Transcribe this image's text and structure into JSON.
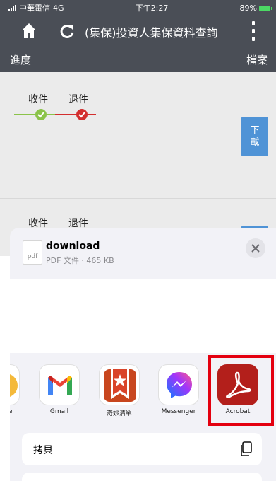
{
  "status_bar": {
    "carrier": "中華電信",
    "network": "4G",
    "time": "下午2:27",
    "battery": "89%"
  },
  "nav": {
    "title": "(集保)投資人集保資料查詢",
    "icons": [
      "home-icon",
      "refresh-icon",
      "more-menu-icon"
    ]
  },
  "table_header": {
    "left": "進度",
    "right": "檔案"
  },
  "rows": [
    {
      "step1": "收件",
      "step2": "退件",
      "download_label_1": "下",
      "download_label_2": "載"
    },
    {
      "step1": "收件",
      "step2": "退件"
    }
  ],
  "share_sheet": {
    "file_icon_text": "pdf",
    "file_name": "download",
    "file_meta": "PDF 文件 · 465 KB",
    "apps": [
      {
        "label": "e"
      },
      {
        "label": "Gmail"
      },
      {
        "label": "奇妙清單"
      },
      {
        "label": "Messenger"
      },
      {
        "label": "Acrobat"
      }
    ],
    "actions": [
      {
        "label": "拷貝",
        "icon": "copy-icon"
      }
    ]
  },
  "colors": {
    "nav_bg": "#4a4e56",
    "accept_green": "#8bc34a",
    "reject_red": "#d32f2f",
    "download_blue": "#4f93d6",
    "highlight_red": "#e4000f",
    "acrobat_red": "#b31f1b"
  }
}
